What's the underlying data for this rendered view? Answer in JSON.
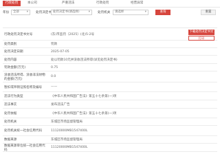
{
  "nav": {
    "active_tab": "行政处罚",
    "tabs": [
      "本公司",
      "严重违法",
      "行政处罚",
      "经营异常"
    ]
  },
  "filter": {
    "label_year": "年份",
    "year_value": "全部",
    "label_type": "处罚决定书",
    "type_value": "处罚决定书(请选择)",
    "label_unit": "处罚机关",
    "unit_value": "请选择",
    "search_btn": "查询",
    "reset_btn": "重置"
  },
  "record": {
    "print_label": "下载处罚决定书文件",
    "print_label2": "打印",
    "rows": [
      {
        "k": "行政处罚决定书文号",
        "v": "(东)市监罚〔2025〕(北)5-2号"
      },
      {
        "k": "处罚类别",
        "v": "罚款"
      },
      {
        "k": "处罚决定日期",
        "v": "2025-07-05"
      },
      {
        "k": "处罚内容",
        "v": "处以罚款10元并没收违法所得(详见处罚决定书)"
      },
      {
        "k": "罚款金额(万元)",
        "v": "0.75"
      },
      {
        "k": "没收违法所得、没收非法财物的金额(万元)",
        "v": "0.0"
      },
      {
        "k": "暂扣或吊销证照名称及编号",
        "v": "——"
      },
      {
        "k": "违法行为类型",
        "v": "《中华人民共和国广告法》第五十七条第(一)项"
      },
      {
        "k": "违法事实",
        "v": "发布违法广告"
      },
      {
        "k": "处罚依据",
        "v": "《中华人民共和国广告法》第五十七条第(一)项"
      },
      {
        "k": "处罚机关",
        "v": "东城区市场监督管理局"
      },
      {
        "k": "处罚机关统一社会信用代码",
        "v": "11120000MB1547400L"
      },
      {
        "k": "数据来源",
        "v": "东城区市场监督管理局"
      },
      {
        "k": "数据来源单位统一社会信用代码",
        "v": "11120000MB1547400L"
      }
    ]
  }
}
